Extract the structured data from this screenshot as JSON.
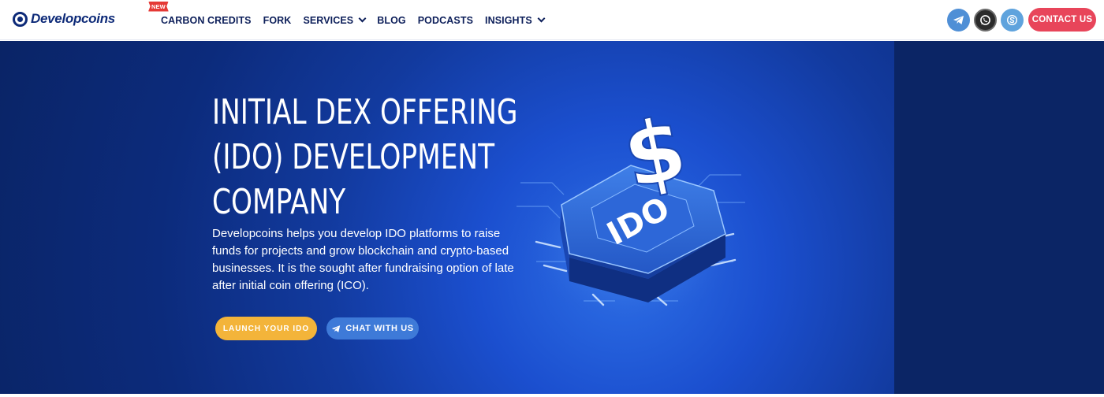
{
  "brand": {
    "name": "Developcoins"
  },
  "nav": {
    "items": [
      {
        "label": "CARBON CREDITS",
        "badge": "NEW",
        "has_dropdown": false
      },
      {
        "label": "FORK",
        "has_dropdown": false
      },
      {
        "label": "SERVICES",
        "has_dropdown": true
      },
      {
        "label": "BLOG",
        "has_dropdown": false
      },
      {
        "label": "PODCASTS",
        "has_dropdown": false
      },
      {
        "label": "INSIGHTS",
        "has_dropdown": true
      }
    ]
  },
  "socials": {
    "icons": [
      "telegram-icon",
      "whatsapp-icon",
      "skype-icon"
    ]
  },
  "contact": {
    "label": "CONTACT US"
  },
  "hero": {
    "title_line1": "INITIAL DEX OFFERING",
    "title_line2": "(IDO) DEVELOPMENT",
    "title_line3": "COMPANY",
    "description": "Developcoins helps you develop IDO platforms to raise funds for projects and grow blockchain and crypto-based businesses. It is the sought after fundraising option of late after initial coin offering (ICO).",
    "launch_label": "LAUNCH YOUR IDO",
    "chat_label": "CHAT WITH US",
    "illustration_text": "IDO",
    "illustration_symbol": "$"
  },
  "colors": {
    "brand_navy": "#0d2a78",
    "hero_bg": "#0a2466",
    "contact_red": "#e8455a",
    "launch_yellow": "#f3b43a",
    "chat_blue": "#3e7ad8"
  }
}
